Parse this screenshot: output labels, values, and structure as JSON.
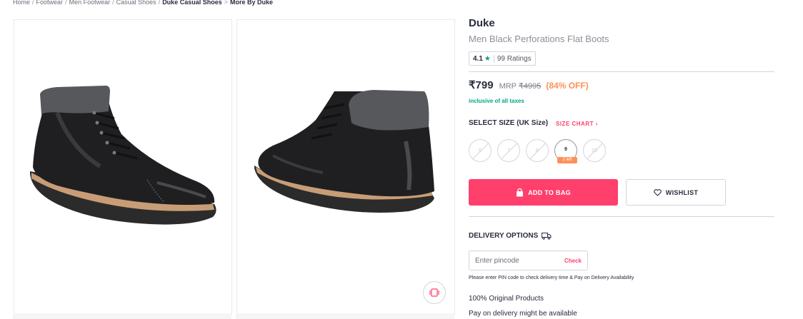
{
  "breadcrumb": {
    "items": [
      "Home",
      "Footwear",
      "Men Footwear",
      "Casual Shoes"
    ],
    "current": "Duke Casual Shoes",
    "more": "More By Duke"
  },
  "product": {
    "brand": "Duke",
    "name": "Men Black Perforations Flat Boots",
    "rating": "4.1",
    "rating_count": "99 Ratings"
  },
  "price": {
    "selling": "₹799",
    "mrp_label": "MRP",
    "mrp": "₹4995",
    "discount": "(84% OFF)",
    "tax_note": "inclusive of all taxes"
  },
  "size": {
    "heading": "SELECT SIZE (UK Size)",
    "chart_label": "SIZE CHART",
    "options": [
      {
        "label": "6",
        "available": false
      },
      {
        "label": "7",
        "available": false
      },
      {
        "label": "8",
        "available": false
      },
      {
        "label": "9",
        "available": true,
        "stock_badge": "2 left"
      },
      {
        "label": "10",
        "available": false
      }
    ]
  },
  "actions": {
    "add_to_bag": "ADD TO BAG",
    "wishlist": "WISHLIST"
  },
  "delivery": {
    "heading": "DELIVERY OPTIONS",
    "pincode_placeholder": "Enter pincode",
    "check_label": "Check",
    "note": "Please enter PIN code to check delivery time & Pay on Delivery Availability",
    "features": [
      "100% Original Products",
      "Pay on delivery might be available"
    ]
  },
  "colors": {
    "accent": "#ff3f6c",
    "discount": "#ff905a",
    "tax": "#03a685",
    "rating_star": "#14958f"
  },
  "icons": {
    "rating": "star-icon",
    "size_chart": "chevron-right-icon",
    "add_to_bag": "bag-icon",
    "wishlist": "heart-icon",
    "delivery": "truck-icon",
    "similar": "similar-products-icon"
  }
}
